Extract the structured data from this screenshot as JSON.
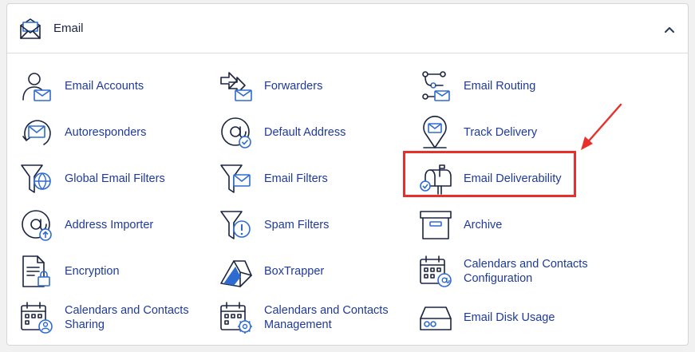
{
  "section": {
    "title": "Email",
    "icon": "envelope-open-icon",
    "collapse_icon": "chevron-up-icon"
  },
  "colors": {
    "link": "#1f3a9a",
    "icon_outline": "#1c2540",
    "icon_accent": "#2e6bd1",
    "highlight": "#e8302b"
  },
  "items": [
    {
      "label": "Email Accounts",
      "icon": "user-envelope-icon"
    },
    {
      "label": "Forwarders",
      "icon": "forward-arrows-icon"
    },
    {
      "label": "Email Routing",
      "icon": "routing-nodes-icon"
    },
    {
      "label": "Autoresponders",
      "icon": "envelope-circular-arrow-icon"
    },
    {
      "label": "Default Address",
      "icon": "at-sign-check-icon"
    },
    {
      "label": "Track Delivery",
      "icon": "map-pin-envelope-icon"
    },
    {
      "label": "Global Email Filters",
      "icon": "funnel-globe-icon"
    },
    {
      "label": "Email Filters",
      "icon": "funnel-envelope-icon"
    },
    {
      "label": "Email Deliverability",
      "icon": "mailbox-check-icon"
    },
    {
      "label": "Address Importer",
      "icon": "at-sign-upload-icon"
    },
    {
      "label": "Spam Filters",
      "icon": "funnel-warning-icon"
    },
    {
      "label": "Archive",
      "icon": "archive-box-icon"
    },
    {
      "label": "Encryption",
      "icon": "document-lock-icon"
    },
    {
      "label": "BoxTrapper",
      "icon": "box-trap-icon"
    },
    {
      "label": "Calendars and Contacts Configuration",
      "icon": "calendar-at-icon"
    },
    {
      "label": "Calendars and Contacts Sharing",
      "icon": "calendar-user-icon"
    },
    {
      "label": "Calendars and Contacts Management",
      "icon": "calendar-gear-icon"
    },
    {
      "label": "Email Disk Usage",
      "icon": "disk-drive-icon"
    }
  ]
}
